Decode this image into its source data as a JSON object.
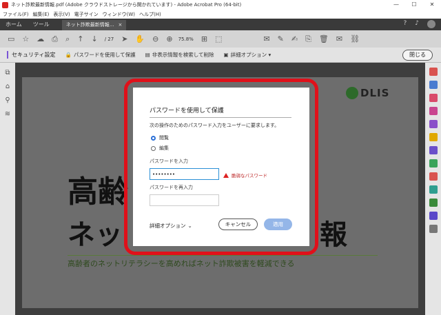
{
  "window": {
    "title": "ネット詐欺最新情報.pdf (Adobe クラウドストレージから開かれています) - Adobe Acrobat Pro (64-bit)",
    "controls": [
      "—",
      "☐",
      "✕"
    ]
  },
  "menubar": {
    "items": [
      "ファイル(F)",
      "編集(E)",
      "表示(V)",
      "電子サイン",
      "ウィンドウ(W)",
      "ヘルプ(H)"
    ]
  },
  "tabs": {
    "home": "ホーム",
    "tools": "ツール",
    "document": "ネット詐欺最新情報...",
    "doc_close": "×"
  },
  "toolbar": {
    "page": "/ 27",
    "zoom": "75.8%"
  },
  "security_bar": {
    "title": "セキュリティ設定",
    "action_password": "パスワードを使用して保護",
    "action_remove_hidden": "非表示情報を検索して削除",
    "action_advanced": "詳細オプション ▾",
    "close": "閉じる"
  },
  "document": {
    "logo": "DLIS",
    "heading_line1": "高齢",
    "heading_line2_left": "ネッ",
    "heading_line2_right": "報",
    "subtitle": "高齢者のネットリテラシーを高めればネット詐欺被害を軽減できる"
  },
  "dialog": {
    "title": "パスワードを使用して保護",
    "description": "次の操作のためのパスワード入力をユーザーに要求します。",
    "option_view": "閲覧",
    "option_edit": "編集",
    "password_label": "パスワードを入力",
    "password_value": "••••••••",
    "warning": "脆弱なパスワード",
    "confirm_label": "パスワードを再入力",
    "confirm_value": "",
    "advanced": "詳細オプション",
    "cancel": "キャンセル",
    "apply": "適用"
  },
  "colors": {
    "highlight_frame": "#e0101a",
    "accent": "#2a6fd6",
    "apply_button": "#94b6e8",
    "security_accent": "#7a55d6"
  }
}
